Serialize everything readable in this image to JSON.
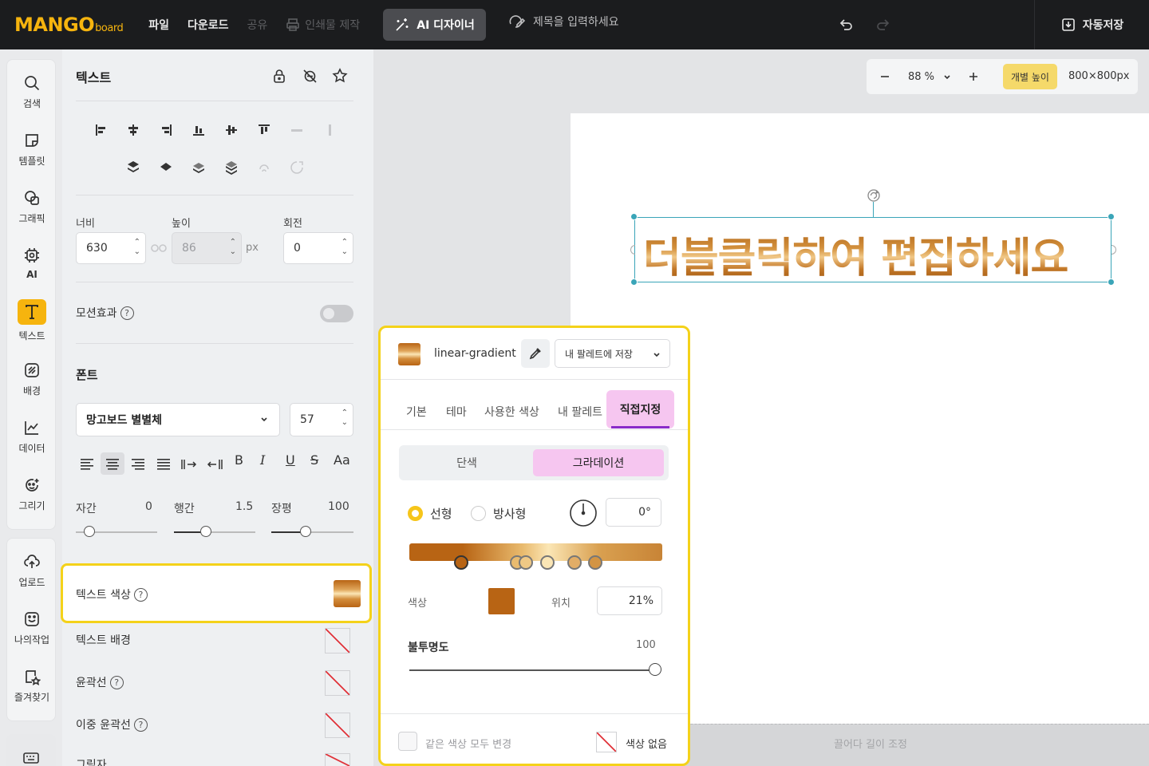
{
  "topbar": {
    "logo_main": "MANGO",
    "logo_sub": "board",
    "menu": [
      "파일",
      "다운로드",
      "공유"
    ],
    "print_label": "인쇄물 제작",
    "ai_label": "AI 디자이너",
    "title_placeholder": "제목을 입력하세요",
    "autosave_label": "자동저장"
  },
  "rail": {
    "items": [
      {
        "label": "검색",
        "icon": "search-icon"
      },
      {
        "label": "템플릿",
        "icon": "template-icon"
      },
      {
        "label": "그래픽",
        "icon": "graphic-icon"
      },
      {
        "label": "AI",
        "icon": "ai-chip-icon"
      },
      {
        "label": "텍스트",
        "icon": "text-icon",
        "active": true
      },
      {
        "label": "배경",
        "icon": "background-icon"
      },
      {
        "label": "데이터",
        "icon": "chart-icon"
      },
      {
        "label": "그리기",
        "icon": "draw-icon"
      }
    ],
    "items2": [
      {
        "label": "업로드",
        "icon": "upload-icon"
      },
      {
        "label": "나의작업",
        "icon": "my-work-icon"
      },
      {
        "label": "즐겨찾기",
        "icon": "favorites-icon"
      }
    ]
  },
  "panel": {
    "title": "텍스트",
    "width_label": "너비",
    "height_label": "높이",
    "rotate_label": "회전",
    "width_value": "630",
    "height_value": "86",
    "unit": "px",
    "rotate_value": "0",
    "motion_label": "모션효과",
    "font_section": "폰트",
    "font_name": "망고보드 별별체",
    "font_size": "57",
    "letter_spacing_label": "자간",
    "letter_spacing_value": "0",
    "line_height_label": "행간",
    "line_height_value": "1.5",
    "width_scale_label": "장평",
    "width_scale_value": "100",
    "text_color_label": "텍스트 색상",
    "text_bg_label": "텍스트 배경",
    "outline_label": "윤곽선",
    "double_outline_label": "이중 윤곽선",
    "shadow_label": "그림자"
  },
  "canvas": {
    "zoom": "88 %",
    "individual_height": "개별 높이",
    "page_size": "800×800px",
    "text": "더블클릭하여 편집하세요",
    "bottom_hint": "끌어다 길이 조정"
  },
  "popup": {
    "fill_type": "linear-gradient",
    "save_palette": "내 팔레트에 저장",
    "tabs": [
      "기본",
      "테마",
      "사용한 색상",
      "내 팔레트",
      "직접지정"
    ],
    "seg_solid": "단색",
    "seg_gradient": "그라데이션",
    "radio_linear": "선형",
    "radio_radial": "방사형",
    "angle": "0°",
    "color_label": "색상",
    "position_label": "위치",
    "position_value": "21%",
    "opacity_label": "불투명도",
    "opacity_value": "100",
    "apply_all_label": "같은 색상 모두 변경",
    "no_color_label": "색상 없음",
    "stop_color": "#b86414"
  }
}
